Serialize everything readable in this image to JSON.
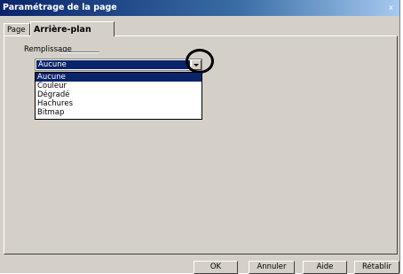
{
  "window": {
    "title": "Paramétrage de la page",
    "close_glyph": "x"
  },
  "tabs": [
    {
      "label": "Page"
    },
    {
      "label": "Arrière-plan",
      "active": true
    }
  ],
  "fill": {
    "group_label": "Remplissage",
    "selected": "Aucune",
    "options": [
      "Aucune",
      "Couleur",
      "Dégradé",
      "Hachures",
      "Bitmap"
    ]
  },
  "buttons": {
    "ok": "OK",
    "cancel": "Annuler",
    "help": "Aide",
    "reset": "Rétablir"
  },
  "colors": {
    "selection": "#0a246a",
    "dialog_bg": "#d4d0c8"
  }
}
